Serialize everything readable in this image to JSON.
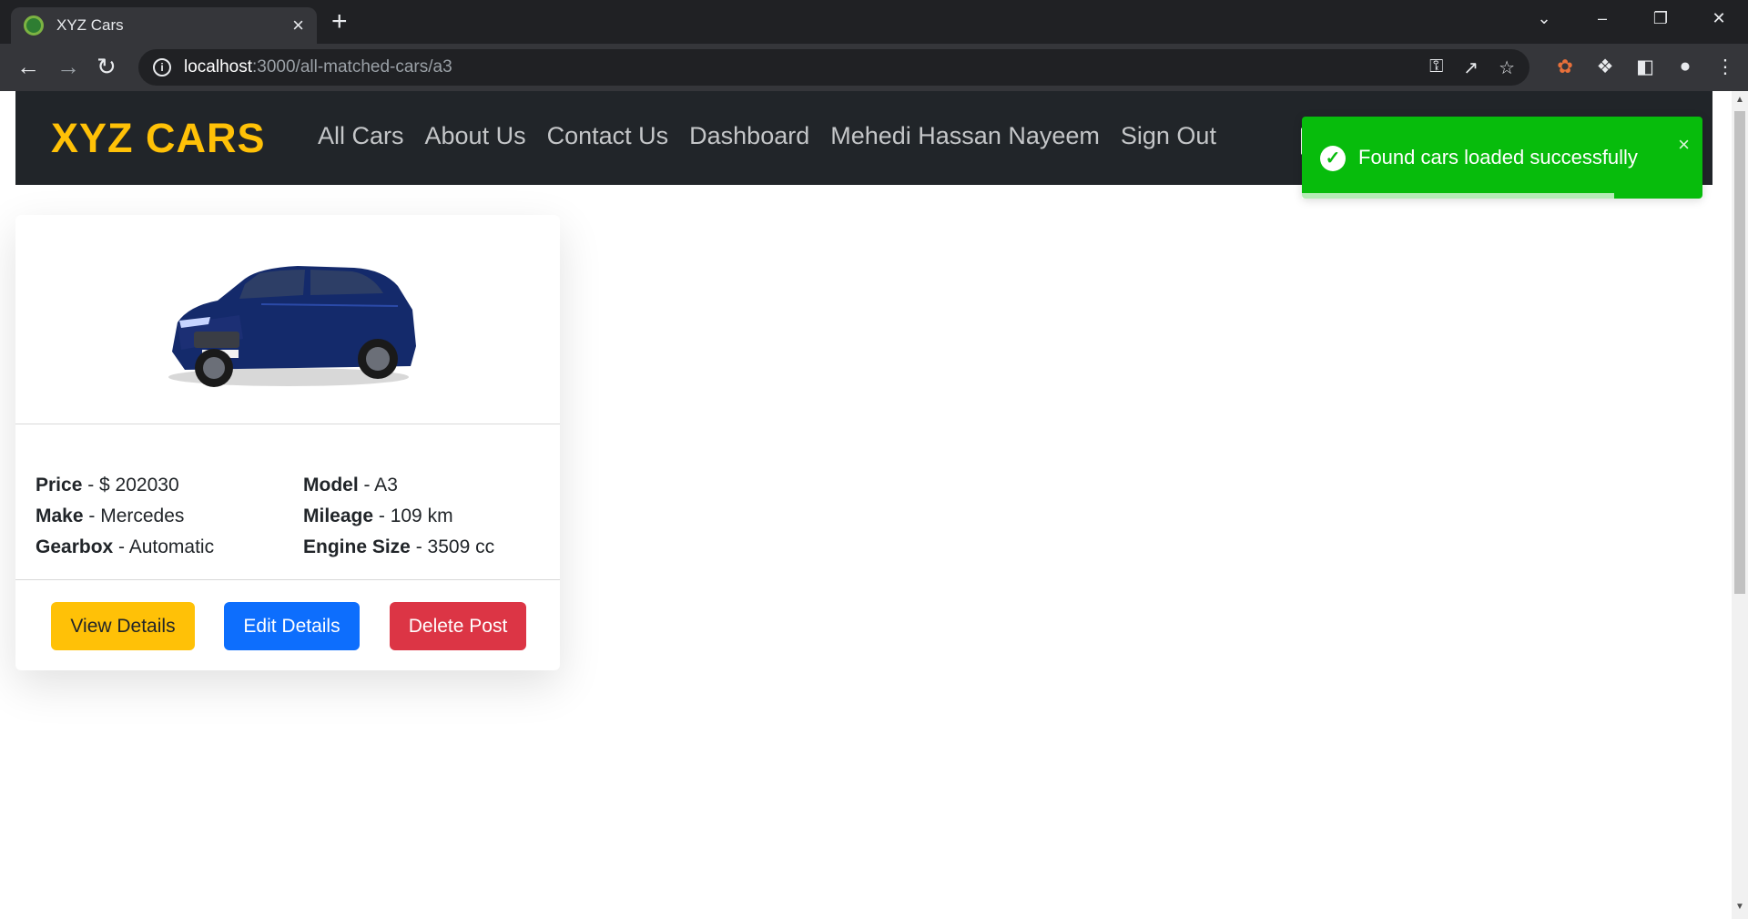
{
  "browser": {
    "tab_title": "XYZ Cars",
    "tab_close": "×",
    "new_tab": "+",
    "url_host": "localhost",
    "url_path": ":3000/all-matched-cars/a3",
    "window_controls": {
      "tab_search": "⌄",
      "minimize": "–",
      "restore": "❐",
      "close": "✕"
    }
  },
  "navbar": {
    "brand": "XYZ CARS",
    "links": [
      "All Cars",
      "About Us",
      "Contact Us",
      "Dashboard",
      "Mehedi Hassan Nayeem",
      "Sign Out"
    ]
  },
  "toast": {
    "message": "Found cars loaded successfully",
    "close": "×",
    "icon": "check-circle-icon",
    "progress_fraction": 0.78,
    "color": "#07bc0c"
  },
  "car": {
    "image": "blue-suv-image",
    "specs": {
      "price_label": "Price",
      "price_value": "- $ 202030",
      "model_label": "Model",
      "model_value": "- A3",
      "make_label": "Make",
      "make_value": "- Mercedes",
      "mileage_label": "Mileage",
      "mileage_value": "- 109 km",
      "gearbox_label": "Gearbox",
      "gearbox_value": "- Automatic",
      "engine_label": "Engine Size",
      "engine_value": "- 3509 cc"
    },
    "buttons": {
      "view": "View Details",
      "edit": "Edit Details",
      "delete": "Delete Post"
    }
  },
  "colors": {
    "brand": "#ffc107",
    "navbar_bg": "#212529",
    "view_btn": "#ffc107",
    "edit_btn": "#0d6efd",
    "delete_btn": "#dc3545"
  }
}
